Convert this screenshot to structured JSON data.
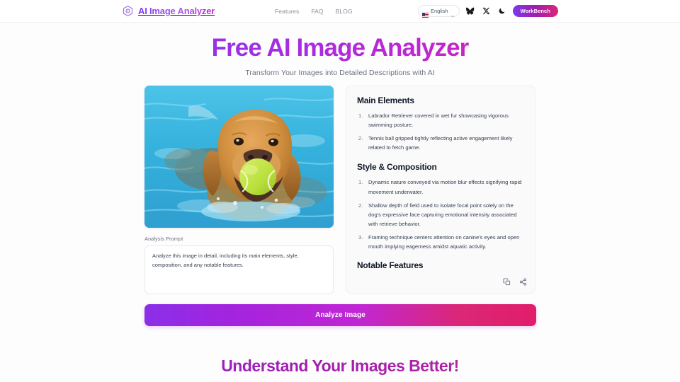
{
  "header": {
    "logo_icon": "hexagon-logo-icon",
    "brand_name": "AI Image Analyzer",
    "nav": [
      {
        "label": "Features",
        "name": "nav-link-features"
      },
      {
        "label": "FAQ",
        "name": "nav-link-faq"
      },
      {
        "label": "BLOG",
        "name": "nav-link-blog"
      }
    ],
    "language": {
      "label": "English",
      "flag": "us-flag-icon",
      "chevron": "chevron-down-icon"
    },
    "social": [
      {
        "name": "bluesky-butterfly-icon"
      },
      {
        "name": "x-twitter-icon"
      },
      {
        "name": "moon-dark-mode-icon"
      }
    ],
    "workbench_label": "WorkBench"
  },
  "hero": {
    "title": "Free AI Image Analyzer",
    "subtitle": "Transform Your Images into Detailed Descriptions with AI"
  },
  "uploaded_image": {
    "alt": "Labrador retriever swimming in blue water holding a tennis ball"
  },
  "prompt": {
    "label": "Analysis Prompt",
    "value": "Analyze this image in detail, including its main elements, style, composition, and any notable features.",
    "placeholder": "Analyze this image in detail, including its main elements, style, composition, and any notable features."
  },
  "analyze_button": {
    "label": "Analyze Image"
  },
  "results": {
    "sections": [
      {
        "title": "Main Elements",
        "items": [
          "Labrador Retriever covered in wet fur showcasing vigorous swimming posture.",
          "Tennis ball gripped tightly reflecting active engagement likely related to fetch game."
        ]
      },
      {
        "title": "Style & Composition",
        "items": [
          "Dynamic nature conveyed via motion blur effects signifying rapid movement underwater.",
          "Shallow depth of field used to isolate focal point solely on the dog's expressive face capturing emotional intensity associated with retrieve behavior.",
          "Framing technique centers attention on canine's eyes and open mouth implying eagerness amidst aquatic activity."
        ]
      },
      {
        "title": "Notable Features",
        "items": []
      }
    ],
    "actions": [
      {
        "name": "copy-icon"
      },
      {
        "name": "share-icon"
      }
    ]
  },
  "bottom": {
    "title": "Understand Your Images Better!"
  },
  "colors": {
    "accent_purple": "#8b2fe8",
    "accent_magenta": "#c026d3",
    "accent_pink": "#db2777",
    "page_bg": "#fdfdfe",
    "panel_bg": "#fafafb",
    "text_muted": "#6b7280"
  }
}
